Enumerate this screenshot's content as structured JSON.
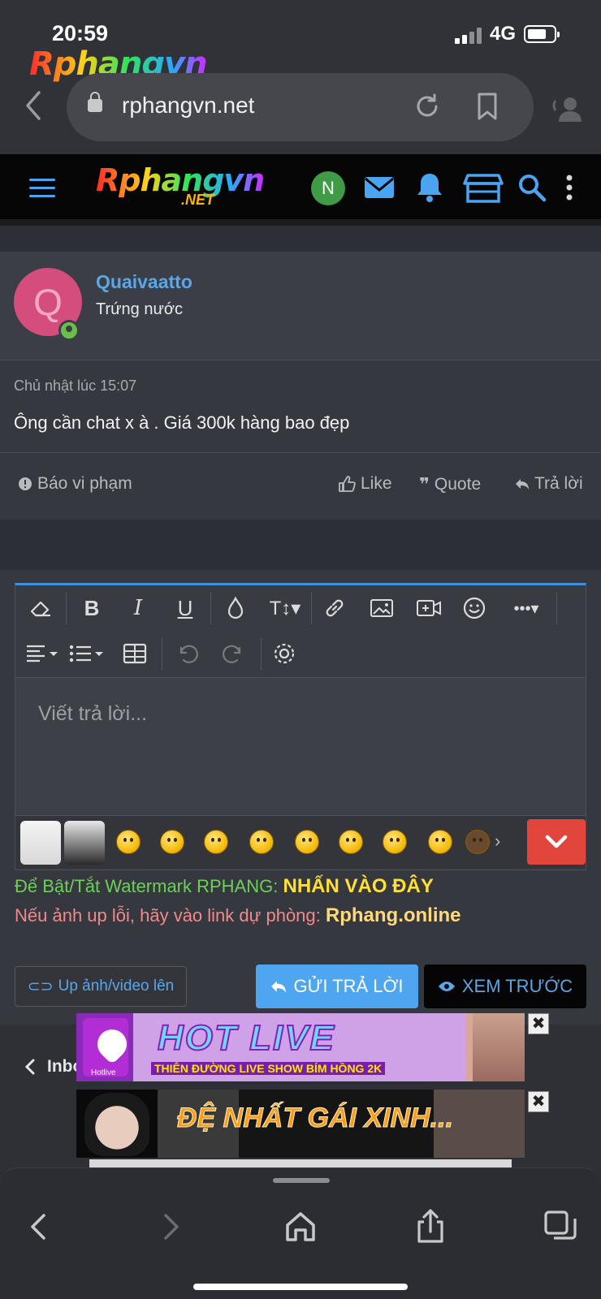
{
  "status_bar": {
    "time": "20:59",
    "network": "4G"
  },
  "browser": {
    "url": "rphangvn.net"
  },
  "brand": {
    "name": "Rphangvn",
    "tld": ".NET"
  },
  "nav": {
    "user_initial": "N"
  },
  "post": {
    "avatar_letter": "Q",
    "username": "Quaivaatto",
    "user_title": "Trứng nước",
    "date": "Chủ nhật lúc 15:07",
    "body": "Ông cần chat x à . Giá 300k hàng bao đẹp",
    "report_label": "Báo vi phạm",
    "like_label": "Like",
    "quote_label": "Quote",
    "reply_label": "Trả lời"
  },
  "editor": {
    "placeholder": "Viết trả lời...",
    "toolbar_row1": [
      "eraser-icon",
      "bold-icon",
      "italic-icon",
      "underline-icon",
      "color-drop-icon",
      "text-size-icon",
      "link-icon",
      "image-icon",
      "video-icon",
      "smile-icon",
      "more-icon"
    ],
    "toolbar_row2": [
      "align-icon",
      "list-icon",
      "table-icon",
      "undo-icon",
      "redo-icon",
      "settings-icon"
    ]
  },
  "watermark": {
    "text": "Để Bật/Tắt Watermark RPHANG: ",
    "link": "NHẤN VÀO ĐÂY"
  },
  "backup": {
    "text": "Nếu ảnh up lỗi, hãy vào link dự phòng: ",
    "link": "Rphang.online"
  },
  "buttons": {
    "upload": "Up ảnh/video lên",
    "submit": "GỬI TRẢ LỜI",
    "preview": "XEM TRƯỚC"
  },
  "lower": {
    "inbox_label": "Inbo"
  },
  "ads": {
    "ad1_title": "HOT LIVE",
    "ad1_subtitle": "THIÊN ĐƯỜNG LIVE SHOW BÍM HỒNG 2K",
    "ad1_logo_caption": "Hotlive",
    "ad2_title": "ĐỆ NHẤT GÁI XINH...",
    "close_glyph": "✖"
  },
  "colors": {
    "accent_blue": "#4fa6f0",
    "link_blue": "#5aa7e8",
    "danger_red": "#e2453c",
    "watermark_green": "#6ecf57",
    "watermark_link": "#ffe033",
    "backup_red": "#f08a8a"
  }
}
